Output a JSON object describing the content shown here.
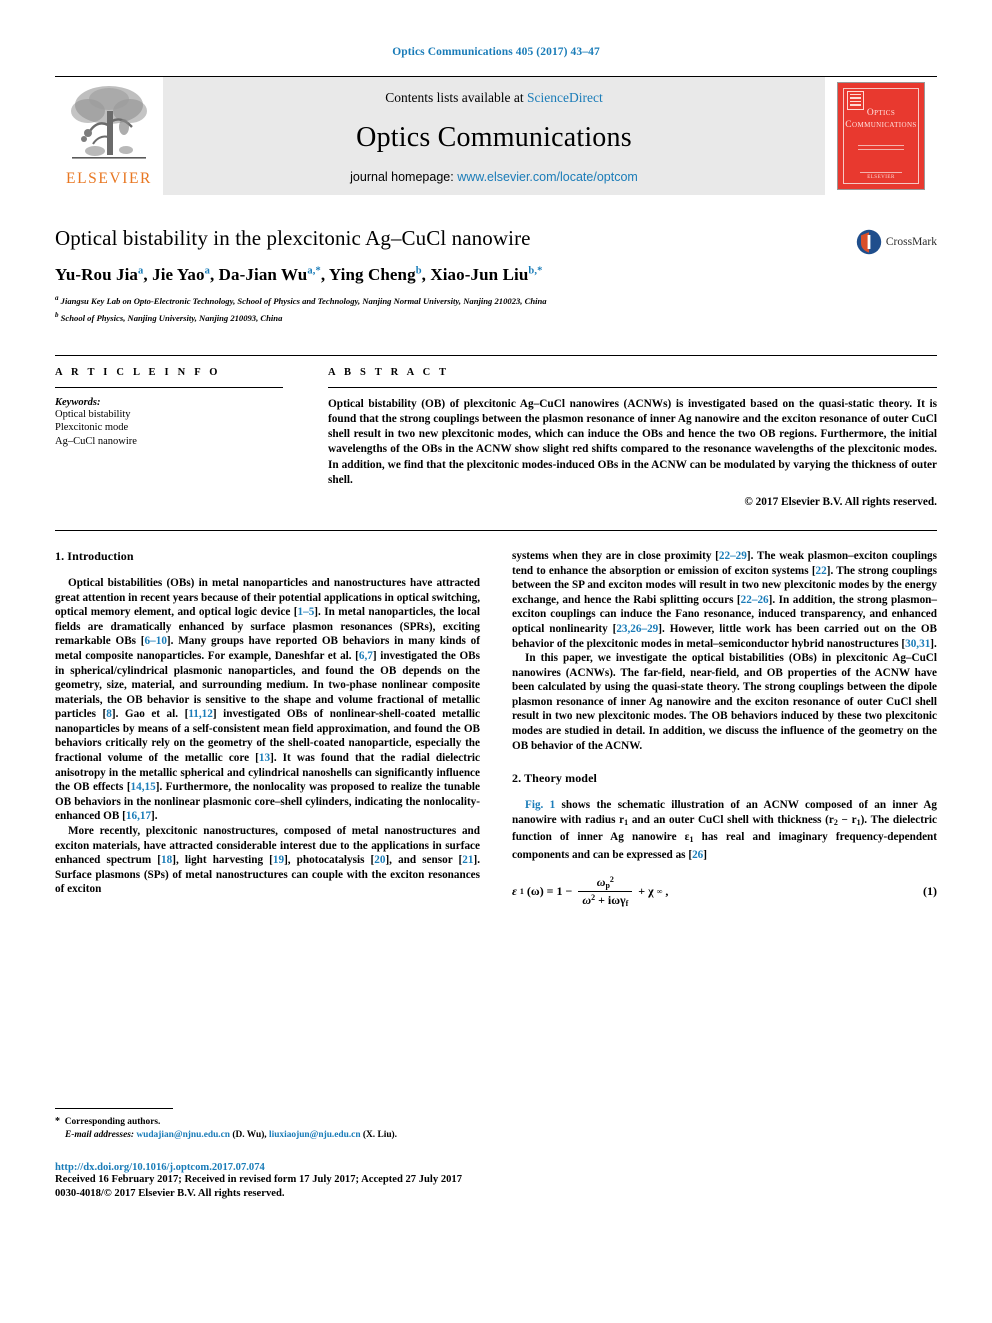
{
  "running_head": "Optics Communications 405 (2017) 43–47",
  "banner": {
    "contents_prefix": "Contents lists available at ",
    "sciencedirect": "ScienceDirect",
    "journal_title": "Optics Communications",
    "homepage_prefix": "journal homepage: ",
    "homepage_url": "www.elsevier.com/locate/optcom",
    "publisher_logo_text": "ELSEVIER",
    "cover_title_line1": "Optics",
    "cover_title_line2": "Communications",
    "cover_publisher": "ELSEVIER"
  },
  "title_block": {
    "title": "Optical bistability in the plexcitonic Ag–CuCl nanowire",
    "crossmark_label": "CrossMark",
    "authors": [
      {
        "name": "Yu-Rou Jia",
        "mark": "a",
        "sep": ", "
      },
      {
        "name": "Jie Yao",
        "mark": "a",
        "sep": ", "
      },
      {
        "name": "Da-Jian Wu",
        "mark": "a,*",
        "sep": ", "
      },
      {
        "name": "Ying Cheng",
        "mark": "b",
        "sep": ", "
      },
      {
        "name": "Xiao-Jun Liu",
        "mark": "b,*",
        "sep": ""
      }
    ],
    "affiliations": [
      {
        "mark": "a",
        "text": "Jiangsu Key Lab on Opto-Electronic Technology, School of Physics and Technology, Nanjing Normal University, Nanjing 210023, China"
      },
      {
        "mark": "b",
        "text": "School of Physics, Nanjing University, Nanjing 210093, China"
      }
    ]
  },
  "article_info": {
    "heading": "A R T I C L E   I N F O",
    "keywords_label": "Keywords:",
    "keywords": [
      "Optical bistability",
      "Plexcitonic mode",
      "Ag–CuCl nanowire"
    ]
  },
  "abstract": {
    "heading": "A B S T R A C T",
    "text": "Optical bistability (OB) of plexcitonic Ag–CuCl nanowires (ACNWs) is investigated based on the quasi-static theory. It is found that the strong couplings between the plasmon resonance of inner Ag nanowire and the exciton resonance of outer CuCl shell result in two new plexcitonic modes, which can induce the OBs and hence the two OB regions. Furthermore, the initial wavelengths of the OBs in the ACNW show slight red shifts compared to the resonance wavelengths of the plexcitonic modes. In addition, we find that the plexcitonic modes-induced OBs in the ACNW can be modulated by varying the thickness of outer shell.",
    "copyright": "© 2017 Elsevier B.V. All rights reserved."
  },
  "sections": {
    "introduction_heading": "1. Introduction",
    "theory_heading": "2. Theory model"
  },
  "left_column": {
    "para1": {
      "seg1": "Optical bistabilities (OBs) in metal nanoparticles and nanostructures have attracted great attention in recent years because of their potential applications in optical switching, optical memory element, and optical logic device [",
      "cite1": "1–5",
      "seg2": "]. In metal nanoparticles, the local fields are dramatically enhanced by surface plasmon resonances (SPRs), exciting remarkable OBs [",
      "cite2": "6–10",
      "seg3": "]. Many groups have reported OB behaviors in many kinds of metal composite nanoparticles. For example, Daneshfar et al. [",
      "cite3": "6,7",
      "seg4": "] investigated the OBs in spherical/cylindrical plasmonic nanoparticles, and found the OB depends on the geometry, size, material, and surrounding medium. In two-phase nonlinear composite materials, the OB behavior is sensitive to the shape and volume fractional of metallic particles [",
      "cite4": "8",
      "seg5": "]. Gao et al. [",
      "cite5": "11,12",
      "seg6": "] investigated OBs of nonlinear-shell-coated metallic nanoparticles by means of a self-consistent mean field approximation, and found the OB behaviors critically rely on the geometry of the shell-coated nanoparticle, especially the fractional volume of the metallic core [",
      "cite6": "13",
      "seg7": "]. It was found that the radial dielectric anisotropy in the metallic spherical and cylindrical nanoshells can significantly influence the OB effects [",
      "cite7": "14,15",
      "seg8": "]. Furthermore, the nonlocality was proposed to realize the tunable OB behaviors in the nonlinear plasmonic core–shell cylinders, indicating the nonlocality-enhanced OB [",
      "cite8": "16,17",
      "seg9": "]."
    },
    "para2": {
      "seg1": "More recently, plexcitonic nanostructures, composed of metal nanostructures and exciton materials, have attracted considerable interest due to the applications in surface enhanced spectrum [",
      "cite1": "18",
      "seg2": "], light harvesting [",
      "cite2": "19",
      "seg3": "], photocatalysis [",
      "cite3": "20",
      "seg4": "], and sensor [",
      "cite4": "21",
      "seg5": "]. Surface plasmons (SPs) of metal nanostructures can couple with the exciton resonances of exciton"
    }
  },
  "right_column": {
    "para1": {
      "seg1": "systems when they are in close proximity [",
      "cite1": "22–29",
      "seg2": "]. The weak plasmon–exciton couplings tend to enhance the absorption or emission of exciton systems [",
      "cite2": "22",
      "seg3": "]. The strong couplings between the SP and exciton modes will result in two new plexcitonic modes by the energy exchange, and hence the Rabi splitting occurs [",
      "cite3": "22–26",
      "seg4": "]. In addition, the strong plasmon–exciton couplings can induce the Fano resonance, induced transparency, and enhanced optical nonlinearity [",
      "cite4": "23,26–29",
      "seg5": "]. However, little work has been carried out on the OB behavior of the plexcitonic modes in metal–semiconductor hybrid nanostructures [",
      "cite5": "30,31",
      "seg6": "]."
    },
    "para2": {
      "text": "In this paper, we investigate the optical bistabilities (OBs) in plexcitonic Ag–CuCl nanowires (ACNWs). The far-field, near-field, and OB properties of the ACNW have been calculated by using the quasi-state theory. The strong couplings between the dipole plasmon resonance of inner Ag nanowire and the exciton resonance of outer CuCl shell result in two new plexcitonic modes. The OB behaviors induced by these two plexcitonic modes are studied in detail. In addition, we discuss the influence of the geometry on the OB behavior of the ACNW."
    },
    "para3": {
      "figref": "Fig. 1",
      "seg1": " shows the schematic illustration of an ACNW composed of an inner Ag nanowire with radius r",
      "sub1": "1",
      "seg2": " and an outer CuCl shell with thickness (r",
      "sub2": "2",
      "seg3": " − r",
      "sub3": "1",
      "seg4": "). The dielectric function of inner Ag nanowire ε",
      "sub4": "1",
      "seg5": " has real and imaginary frequency-dependent components and can be expressed as [",
      "cite1": "26",
      "seg6": "]"
    },
    "equation": {
      "lhs": "ε",
      "lhs_sub": "1",
      "lhs_arg": "(ω) = 1 −",
      "num": "ω",
      "num_sub": "p",
      "num_sup": "2",
      "den_a": "ω",
      "den_sup": "2",
      "den_b": " + iωγ",
      "den_sub": "f",
      "tail": "+ χ",
      "tail_sub": "∞",
      "tail_comma": ",",
      "number": "(1)"
    }
  },
  "footnotes": {
    "star": "*",
    "corresponding": "Corresponding authors.",
    "email_label": "E-mail addresses:",
    "email1": "wudajian@njnu.edu.cn",
    "email1_owner": "(D. Wu),",
    "email2": "liuxiaojun@nju.edu.cn",
    "email2_owner": "(X. Liu)."
  },
  "footer": {
    "doi": "http://dx.doi.org/10.1016/j.optcom.2017.07.074",
    "dates": "Received 16 February 2017; Received in revised form 17 July 2017; Accepted 27 July 2017",
    "issn": "0030-4018/© 2017 Elsevier B.V. All rights reserved."
  },
  "colors": {
    "link_blue": "#1a7cb8",
    "elsevier_orange": "#e87722",
    "cover_red": "#e8392f",
    "banner_gray": "#e9e9e9"
  }
}
